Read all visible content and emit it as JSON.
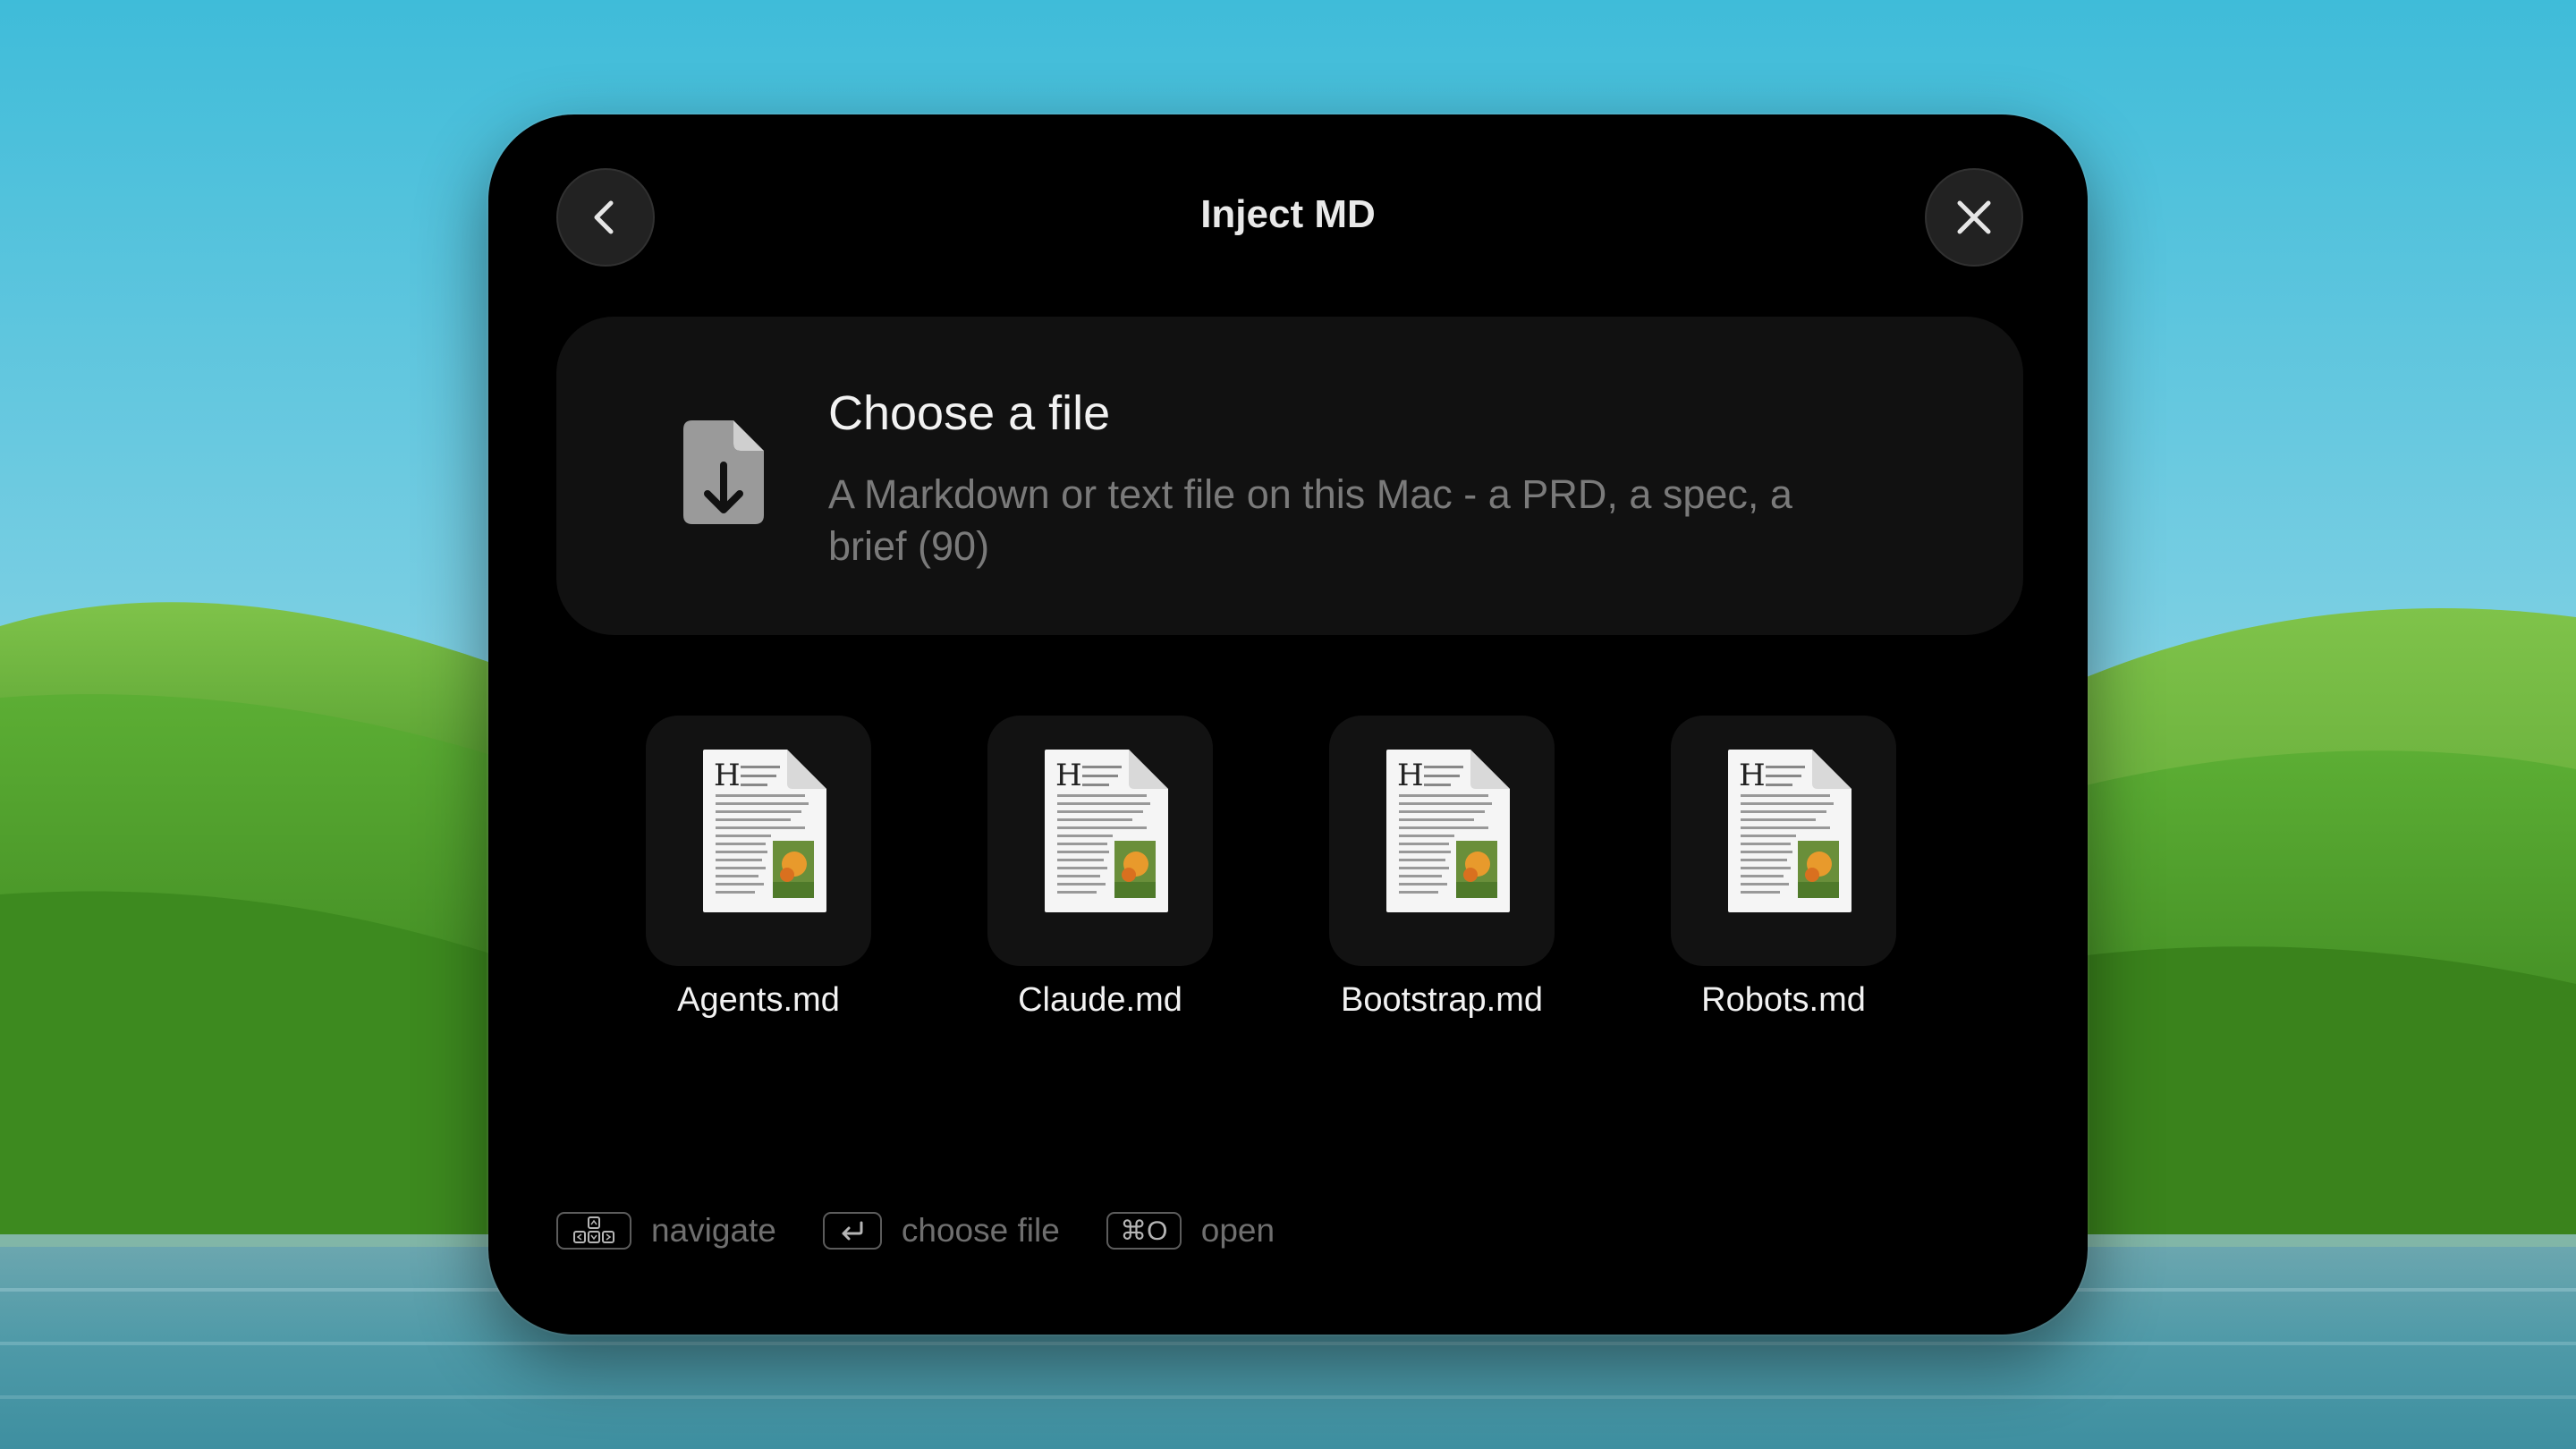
{
  "dialog": {
    "title": "Inject MD",
    "back_icon": "chevron-left-icon",
    "close_icon": "close-icon"
  },
  "choose": {
    "icon": "file-download-icon",
    "title": "Choose a file",
    "description": "A Markdown or text file on this Mac - a PRD, a spec, a brief (90)"
  },
  "files": [
    {
      "name": "Agents.md",
      "icon": "text-document-icon"
    },
    {
      "name": "Claude.md",
      "icon": "text-document-icon"
    },
    {
      "name": "Bootstrap.md",
      "icon": "text-document-icon"
    },
    {
      "name": "Robots.md",
      "icon": "text-document-icon"
    }
  ],
  "hints": [
    {
      "key_icon": "arrow-keys-icon",
      "label": "navigate"
    },
    {
      "key_icon": "return-key-icon",
      "label": "choose file"
    },
    {
      "key": "⌘O",
      "label": "open"
    }
  ],
  "colors": {
    "panel": "#000000",
    "card": "#111111",
    "tile": "#121212",
    "button": "#222222",
    "text_primary": "#f2f2f2",
    "text_secondary": "#7a7a7a"
  }
}
